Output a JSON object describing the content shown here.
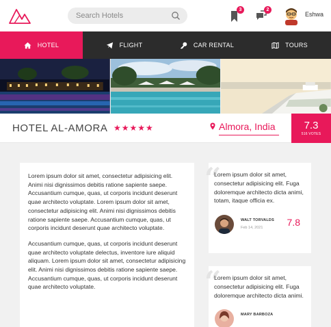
{
  "header": {
    "search_placeholder": "Search Hotels",
    "notifications_count": "3",
    "messages_count": "2",
    "username": "Eshwa"
  },
  "nav": {
    "items": [
      {
        "label": "HOTEL",
        "icon": "home-icon",
        "active": true
      },
      {
        "label": "FLIGHT",
        "icon": "plane-icon",
        "active": false
      },
      {
        "label": "CAR RENTAL",
        "icon": "key-icon",
        "active": false
      },
      {
        "label": "TOURS",
        "icon": "map-icon",
        "active": false
      }
    ]
  },
  "hotel": {
    "name": "HOTEL AL-AMORA",
    "stars": "★★★★★",
    "star_count": 5,
    "location": "Almora, India",
    "rating": "7.3",
    "votes": "516 VOTES"
  },
  "description": {
    "paragraphs": [
      "Lorem ipsum dolor sit amet, consectetur adipisicing elit. Animi nisi dignissimos debitis ratione sapiente saepe. Accusantium cumque, quas, ut corporis incidunt deserunt quae architecto voluptate. Lorem ipsum dolor sit amet, consectetur adipisicing elit. Animi nisi dignissimos debitis ratione sapiente saepe. Accusantium cumque, quas, ut corporis incidunt deserunt quae architecto voluptate.",
      "Accusantium cumque, quas, ut corporis incidunt deserunt quae architecto voluptate delectus, inventore iure aliquid aliquam. Lorem ipsum dolor sit amet, consectetur adipisicing elit. Animi nisi dignissimos debitis ratione sapiente saepe. Accusantium cumque, quas, ut corporis incidunt deserunt quae architecto voluptate."
    ]
  },
  "reviews": [
    {
      "text": "Lorem ipsum dolor sit amet, consectetur adipisicing elit. Fuga doloremque architecto dicta animi, totam, itaque officia ex.",
      "name": "WALT TORVALDS",
      "date": "Feb 14, 2021",
      "score": "7.8"
    },
    {
      "text": "Lorem ipsum dolor sit amet, consectetur adipisicing elit. Fuga doloremque architecto dicta animi.",
      "name": "MARY BARBOZA",
      "date": "",
      "score": ""
    }
  ],
  "colors": {
    "accent": "#e8195a",
    "nav_bg": "#2c2c2c",
    "page_bg": "#f1f1f1"
  }
}
